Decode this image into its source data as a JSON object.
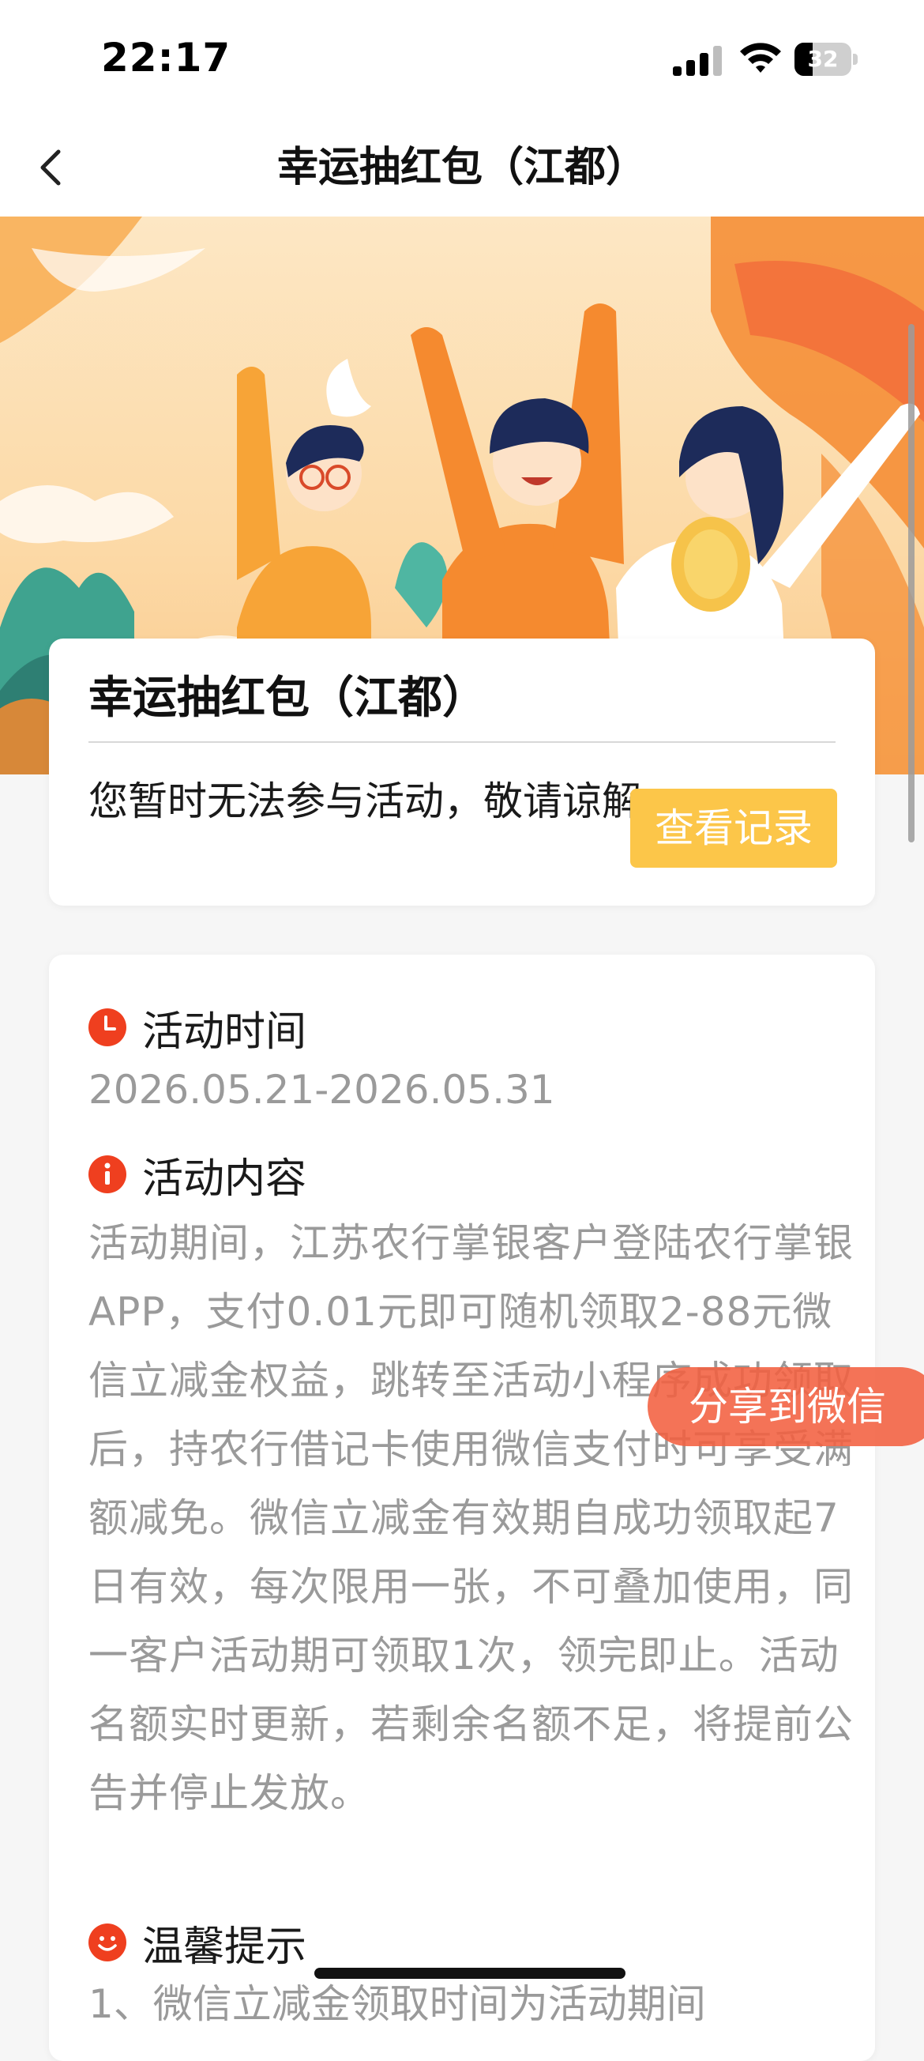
{
  "status_bar": {
    "time": "22:17",
    "battery_level": 32,
    "battery_text": "32",
    "signal_icon": "cellular-signal-icon",
    "wifi_icon": "wifi-icon",
    "battery_icon": "battery-icon"
  },
  "nav": {
    "title": "幸运抽红包（江都）",
    "back_icon": "chevron-left-icon"
  },
  "banner": {
    "image": "celebration-illustration",
    "colors": {
      "sky": "#fde7c4",
      "accent_orange": "#f58a2f",
      "hair": "#1d2b5a",
      "coin": "#f6c34a",
      "teal": "#3fa38f"
    }
  },
  "card": {
    "title": "幸运抽红包（江都）",
    "message": "您暂时无法参与活动，敬请谅解",
    "view_records_label": "查看记录",
    "button_color": "#fcc649"
  },
  "activity": {
    "time_label": "活动时间",
    "time_value": "2026.05.21-2026.05.31",
    "time_icon": "clock-icon",
    "content_label": "活动内容",
    "content_icon": "info-icon",
    "content_text": "活动期间，江苏农行掌银客户登陆农行掌银APP，支付0.01元即可随机领取2-88元微信立减金权益，跳转至活动小程序成功领取后，持农行借记卡使用微信支付时可享受满额减免。微信立减金有效期自成功领取起7日有效，每次限用一张，不可叠加使用，同一客户活动期可领取1次，领完即止。活动名额实时更新，若剩余名额不足，将提前公告并停止发放。",
    "tips_label": "温馨提示",
    "tips_icon": "smile-icon",
    "tips_first_line": "1、微信立减金领取时间为活动期间",
    "icon_color": "#ef3f1f"
  },
  "share": {
    "label": "分享到微信",
    "color": "#f36040"
  }
}
